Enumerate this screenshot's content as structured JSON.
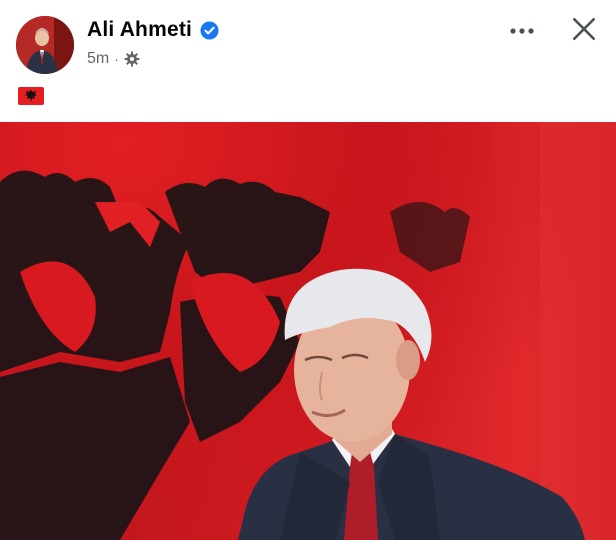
{
  "post": {
    "author_name": "Ali Ahmeti",
    "verified_icon": "verified-badge-icon",
    "timestamp": "5m",
    "separator": "·",
    "audience_icon": "gear-icon",
    "caption_emoji": "albania-flag-emoji",
    "more_icon": "more-horizontal-icon",
    "close_icon": "close-icon"
  },
  "colors": {
    "verified_blue": "#1877f2",
    "name_text": "#050505",
    "meta_text": "#65676b",
    "flag_red": "#e41e20",
    "flag_eagle": "#000000"
  }
}
